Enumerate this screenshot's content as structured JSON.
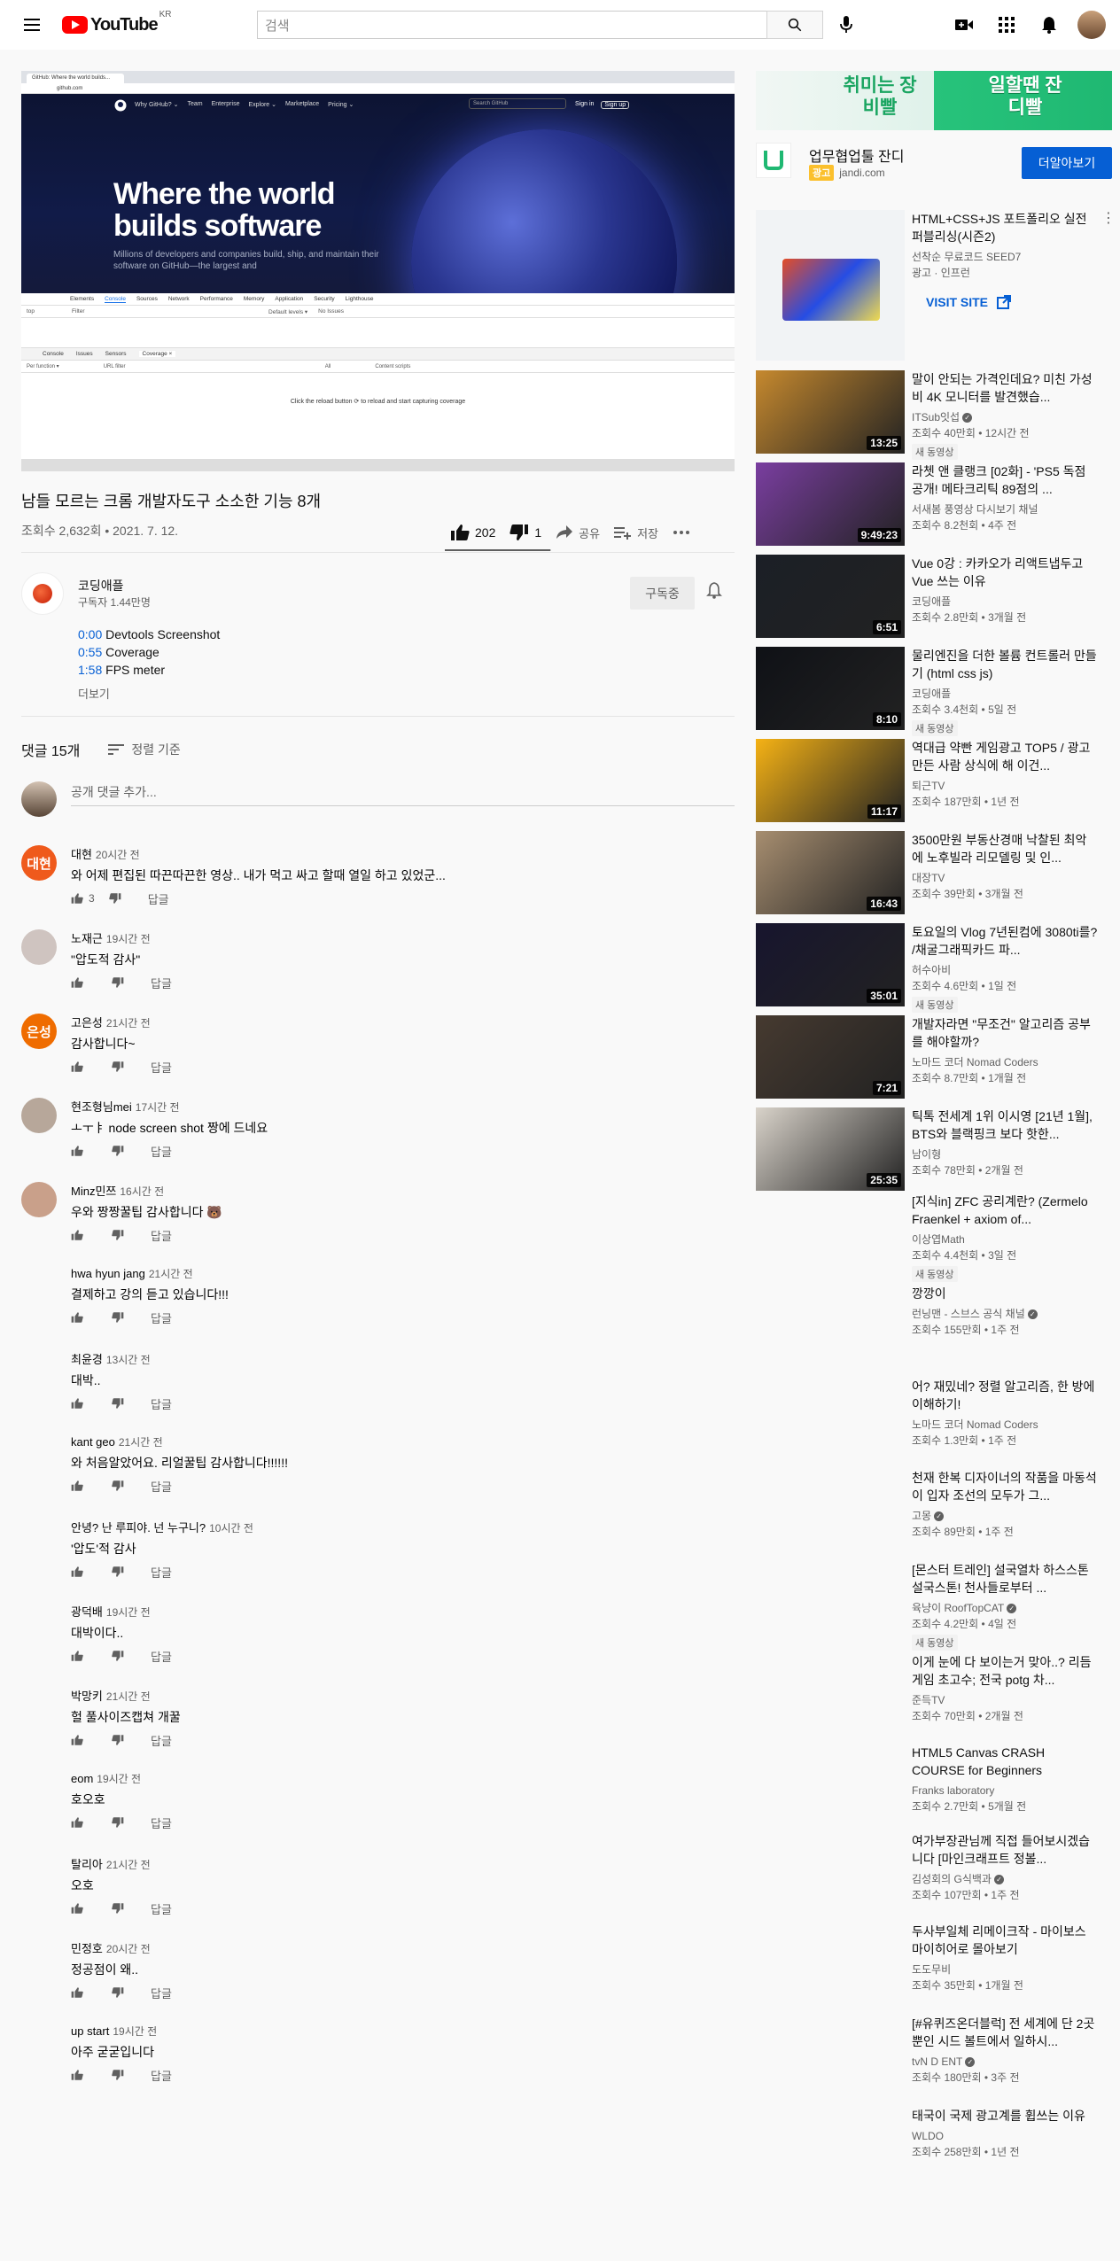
{
  "header": {
    "logo_text": "YouTube",
    "logo_region": "KR",
    "search_placeholder": "검색"
  },
  "player": {
    "tab_title": "GitHub: Where the world builds...",
    "url": "github.com",
    "nav_items": [
      "Why GitHub? ⌄",
      "Team",
      "Enterprise",
      "Explore ⌄",
      "Marketplace",
      "Pricing ⌄"
    ],
    "search_placeholder": "Search GitHub",
    "sign_in": "Sign in",
    "sign_up": "Sign up",
    "headline_1": "Where the world",
    "headline_2": "builds software",
    "subtext": "Millions of developers and companies build, ship, and maintain their software on GitHub—the largest and",
    "devtools_tabs": [
      "Elements",
      "Console",
      "Sources",
      "Network",
      "Performance",
      "Memory",
      "Application",
      "Security",
      "Lighthouse"
    ],
    "devtools_ctx": "top",
    "devtools_filter": "Filter",
    "devtools_levels": "Default levels ▾",
    "devtools_issues": "No Issues",
    "drawer_tabs": [
      "Console",
      "Issues",
      "Sensors",
      "Coverage ×"
    ],
    "coverage_type": "Per function ▾",
    "coverage_url_filter": "URL filter",
    "coverage_all": "All",
    "coverage_content": "Content scripts",
    "coverage_msg": "Click the reload button",
    "coverage_msg2": "to reload and start capturing coverage"
  },
  "video": {
    "title": "남들 모르는 크롬 개발자도구 소소한 기능 8개",
    "views_date": "조회수 2,632회 • 2021. 7. 12.",
    "like_count": "202",
    "dislike_count": "1",
    "share": "공유",
    "save": "저장",
    "like_ratio": 0.995
  },
  "channel": {
    "name": "코딩애플",
    "subs": "구독자 1.44만명",
    "subscribe": "구독중",
    "chapters": [
      {
        "time": "0:00",
        "label": "Devtools Screenshot"
      },
      {
        "time": "0:55",
        "label": "Coverage"
      },
      {
        "time": "1:58",
        "label": "FPS meter"
      }
    ],
    "more": "더보기"
  },
  "comments_header": {
    "count": "댓글 15개",
    "sort": "정렬 기준",
    "add_placeholder": "공개 댓글 추가..."
  },
  "comments": [
    {
      "author": "대현",
      "time": "20시간 전",
      "text": "와 어제 편집된 따끈따끈한 영상.. 내가 먹고 싸고 할때 열일 하고 있었군...",
      "likes": "3",
      "avatar_text": "대현",
      "avatar_color": "#ef5a1c"
    },
    {
      "author": "노재근",
      "time": "19시간 전",
      "text": "\"압도적 감사\"",
      "likes": "",
      "avatar_text": "",
      "avatar_color": "#cfc4c0"
    },
    {
      "author": "고은성",
      "time": "21시간 전",
      "text": "감사합니다~",
      "likes": "",
      "avatar_text": "은성",
      "avatar_color": "#ef6c00"
    },
    {
      "author": "현조형님mei",
      "time": "17시간 전",
      "text": "ㅗㅜㅑ node screen shot 짱에 드네요",
      "likes": "",
      "avatar_text": "",
      "avatar_color": "#b7a79a"
    },
    {
      "author": "Minz민쯔",
      "time": "16시간 전",
      "text": "우와 짱짱꿀팁 감사합니다 🐻",
      "likes": "",
      "avatar_text": "",
      "avatar_color": "#c9a08a"
    },
    {
      "author": "hwa hyun jang",
      "time": "21시간 전",
      "text": "결제하고 강의 듣고 있습니다!!!",
      "likes": "",
      "avatar_text": "",
      "avatar_color": ""
    },
    {
      "author": "최윤경",
      "time": "13시간 전",
      "text": "대박..",
      "likes": "",
      "avatar_text": "",
      "avatar_color": ""
    },
    {
      "author": "kant geo",
      "time": "21시간 전",
      "text": "와 처음알았어요. 리얼꿀팁 감사합니다!!!!!!",
      "likes": "",
      "avatar_text": "",
      "avatar_color": ""
    },
    {
      "author": "안녕? 난 루피야. 넌 누구니?",
      "time": "10시간 전",
      "text": "'압도'적 감사",
      "likes": "",
      "avatar_text": "",
      "avatar_color": ""
    },
    {
      "author": "광덕배",
      "time": "19시간 전",
      "text": "대박이다..",
      "likes": "",
      "avatar_text": "",
      "avatar_color": ""
    },
    {
      "author": "박망키",
      "time": "21시간 전",
      "text": "헐 풀사이즈캡쳐 개꿀",
      "likes": "",
      "avatar_text": "",
      "avatar_color": ""
    },
    {
      "author": "eom",
      "time": "19시간 전",
      "text": "호오호",
      "likes": "",
      "avatar_text": "",
      "avatar_color": ""
    },
    {
      "author": "탈리아",
      "time": "21시간 전",
      "text": "오호",
      "likes": "",
      "avatar_text": "",
      "avatar_color": ""
    },
    {
      "author": "민정호",
      "time": "20시간 전",
      "text": "정공점이 왜..",
      "likes": "",
      "avatar_text": "",
      "avatar_color": ""
    },
    {
      "author": "up start",
      "time": "19시간 전",
      "text": "아주 굳굳입니다",
      "likes": "",
      "avatar_text": "",
      "avatar_color": ""
    }
  ],
  "reply_label": "답글",
  "ad": {
    "banner_left": "취미는 장비빨",
    "banner_right": "일할땐 잔디빨",
    "title": "업무협업툴 잔디",
    "badge": "광고",
    "domain": "jandi.com",
    "cta": "더알아보기"
  },
  "related": [
    {
      "title": "HTML+CSS+JS 포트폴리오 실전 퍼블리싱(시즌2)",
      "channel": "선착순 무료코드 SEED7",
      "stats": "광고 · 인프런",
      "duration": "",
      "new": "",
      "visit": "VISIT SITE",
      "thumb": "#f1f3f5"
    },
    {
      "title": "말이 안되는 가격인데요? 미친 가성비 4K 모니터를 발견했습...",
      "channel": "ITSub잇섭",
      "stats": "조회수 40만회 • 12시간 전",
      "duration": "13:25",
      "new": "새 동영상",
      "verified": true,
      "thumb": "#c6892e"
    },
    {
      "title": "라쳇 앤 클랭크 [02화] - 'PS5 독점 공개! 메타크리틱 89점의 ...",
      "channel": "서새봄 풍영상 다시보기 채널",
      "stats": "조회수 8.2천회 • 4주 전",
      "duration": "9:49:23",
      "new": "",
      "thumb": "#7a3ea0"
    },
    {
      "title": "Vue 0강 : 카카오가 리액트냅두고 Vue 쓰는 이유",
      "channel": "코딩애플",
      "stats": "조회수 2.8만회 • 3개월 전",
      "duration": "6:51",
      "new": "",
      "thumb": "#1b1f26"
    },
    {
      "title": "물리엔진을 더한 볼륨 컨트롤러 만들기 (html css js)",
      "channel": "코딩애플",
      "stats": "조회수 3.4천회 • 5일 전",
      "duration": "8:10",
      "new": "새 동영상",
      "thumb": "#0f1116"
    },
    {
      "title": "역대급 약빤 게임광고 TOP5 / 광고 만든 사람 상식에 해 이건...",
      "channel": "퇴근TV",
      "stats": "조회수 187만회 • 1년 전",
      "duration": "11:17",
      "new": "",
      "thumb": "#f5b215"
    },
    {
      "title": "3500만원 부동산경매 낙찰된 최악에 노후빌라 리모델링 및 인...",
      "channel": "대장TV",
      "stats": "조회수 39만회 • 3개월 전",
      "duration": "16:43",
      "new": "",
      "thumb": "#a78e70"
    },
    {
      "title": "토요일의 Vlog 7년된컴에 3080ti를? /채굴그래픽카드 파...",
      "channel": "허수아비",
      "stats": "조회수 4.6만회 • 1일 전",
      "duration": "35:01",
      "new": "새 동영상",
      "thumb": "#17152e"
    },
    {
      "title": "개발자라면 \"무조건\" 알고리즘 공부를 해야할까?",
      "channel": "노마드 코더 Nomad Coders",
      "stats": "조회수 8.7만회 • 1개월 전",
      "duration": "7:21",
      "new": "",
      "thumb": "#463a30"
    },
    {
      "title": "틱톡 전세계 1위 이시영 [21년 1월], BTS와 블랙핑크 보다 핫한...",
      "channel": "남이형",
      "stats": "조회수 78만회 • 2개월 전",
      "duration": "25:35",
      "new": "",
      "thumb": "#d9d3ca"
    },
    {
      "title": "[지식in] ZFC 공리계란? (Zermelo Fraenkel + axiom of...",
      "channel": "이상엽Math",
      "stats": "조회수 4.4천회 • 3일 전",
      "duration": "",
      "new": "새 동영상",
      "thumb": ""
    },
    {
      "title": "깡깡이",
      "channel": "런닝맨 - 스브스 공식 채널",
      "stats": "조회수 155만회 • 1주 전",
      "duration": "",
      "new": "",
      "verified": true,
      "thumb": ""
    },
    {
      "title": "어? 재밌네? 정렬 알고리즘, 한 방에 이해하기!",
      "channel": "노마드 코더 Nomad Coders",
      "stats": "조회수 1.3만회 • 1주 전",
      "duration": "",
      "new": "",
      "thumb": ""
    },
    {
      "title": "천재 한복 디자이너의 작품을 마동석이 입자 조선의 모두가 그...",
      "channel": "고몽",
      "stats": "조회수 89만회 • 1주 전",
      "duration": "",
      "new": "",
      "verified": true,
      "thumb": ""
    },
    {
      "title": "[몬스터 트레인] 설국열차 하스스톤 설국스톤! 천사들로부터 ...",
      "channel": "육냥이 RoofTopCAT",
      "stats": "조회수 4.2만회 • 4일 전",
      "duration": "",
      "new": "새 동영상",
      "verified": true,
      "thumb": ""
    },
    {
      "title": "이게 눈에 다 보이는거 맞아..? 리듬게임 초고수; 전국 potg 차...",
      "channel": "준득TV",
      "stats": "조회수 70만회 • 2개월 전",
      "duration": "",
      "new": "",
      "thumb": ""
    },
    {
      "title": "HTML5 Canvas CRASH COURSE for Beginners",
      "channel": "Franks laboratory",
      "stats": "조회수 2.7만회 • 5개월 전",
      "duration": "",
      "new": "",
      "thumb": ""
    },
    {
      "title": "여가부장관님께 직접 들어보시겠습니다 [마인크래프트 정볼...",
      "channel": "김성회의 G식백과",
      "stats": "조회수 107만회 • 1주 전",
      "duration": "",
      "new": "",
      "verified": true,
      "thumb": ""
    },
    {
      "title": "두사부일체 리메이크작 - 마이보스 마이히어로 몰아보기",
      "channel": "도도무비",
      "stats": "조회수 35만회 • 1개월 전",
      "duration": "",
      "new": "",
      "thumb": ""
    },
    {
      "title": "[#유퀴즈온더블럭] 전 세계에 단 2곳뿐인 시드 볼트에서 일하시...",
      "channel": "tvN D ENT",
      "stats": "조회수 180만회 • 3주 전",
      "duration": "",
      "new": "",
      "verified": true,
      "thumb": ""
    },
    {
      "title": "태국이 국제 광고계를 휩쓰는 이유",
      "channel": "WLDO",
      "stats": "조회수 258만회 • 1년 전",
      "duration": "",
      "new": "",
      "thumb": ""
    }
  ]
}
